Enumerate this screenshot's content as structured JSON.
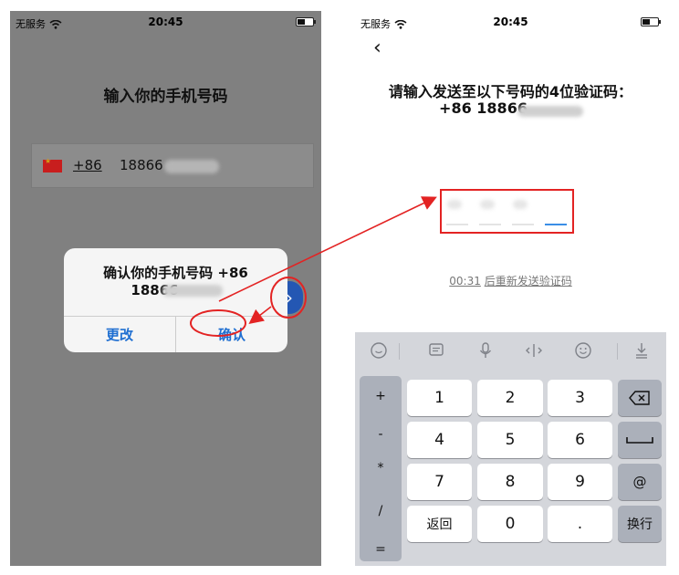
{
  "left_screen": {
    "status": {
      "carrier": "无服务",
      "time": "20:45"
    },
    "title": "输入你的手机号码",
    "phone_input": {
      "country_code": "+86",
      "number_visible": "18866"
    },
    "dialog": {
      "message_line1": "确认你的手机号码 +86",
      "message_line2": "18866",
      "change_label": "更改",
      "confirm_label": "确认"
    }
  },
  "right_screen": {
    "status": {
      "carrier": "无服务",
      "time": "20:45"
    },
    "title_line1": "请输入发送至以下号码的4位验证码：",
    "title_line2": "+86 18866",
    "resend": {
      "countdown": "00:31",
      "text": "后重新发送验证码"
    },
    "keyboard": {
      "symbols": [
        "+",
        "-",
        "*",
        "/",
        "="
      ],
      "keys": [
        "1",
        "2",
        "3",
        "4",
        "5",
        "6",
        "7",
        "8",
        "9",
        "返回",
        "0",
        ".",
        "@",
        "换行"
      ]
    }
  },
  "colors": {
    "accent": "#1f6fd1",
    "annotation_red": "#e32323",
    "next_button": "#2457b3",
    "overlay_gray": "#808080"
  }
}
